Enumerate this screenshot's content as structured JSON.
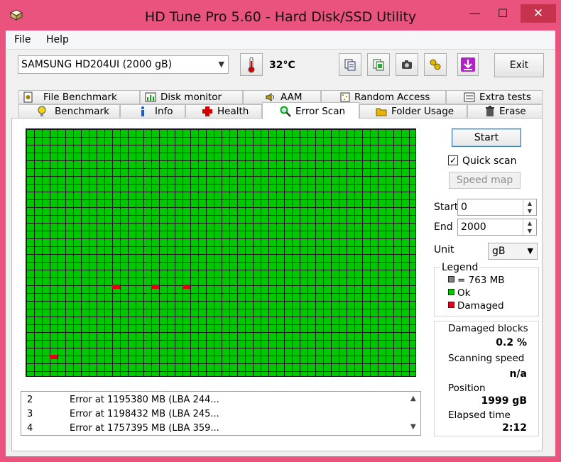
{
  "window": {
    "title": "HD Tune Pro 5.60 - Hard Disk/SSD Utility",
    "min_glyph": "—",
    "max_glyph": "☐",
    "close_glyph": "✕"
  },
  "menu": [
    {
      "label": "File"
    },
    {
      "label": "Help"
    }
  ],
  "toolbar": {
    "drive": "SAMSUNG HD204UI (2000 gB)",
    "temperature": "32°C",
    "exit_label": "Exit",
    "buttons": [
      "copy-text-icon",
      "copy-info-icon",
      "screenshot-camera-icon",
      "options-icon",
      "save-download-icon"
    ]
  },
  "tabs_top": [
    {
      "label": "File Benchmark",
      "icon": "file-benchmark-icon"
    },
    {
      "label": "Disk monitor",
      "icon": "disk-monitor-icon"
    },
    {
      "label": "AAM",
      "icon": "speaker-icon"
    },
    {
      "label": "Random Access",
      "icon": "random-access-icon"
    },
    {
      "label": "Extra tests",
      "icon": "extra-tests-icon"
    }
  ],
  "tabs_bottom": [
    {
      "label": "Benchmark",
      "icon": "bulb-icon"
    },
    {
      "label": "Info",
      "icon": "info-icon"
    },
    {
      "label": "Health",
      "icon": "health-cross-icon"
    },
    {
      "label": "Error Scan",
      "icon": "magnifier-icon",
      "active": true
    },
    {
      "label": "Folder Usage",
      "icon": "folder-icon"
    },
    {
      "label": "Erase",
      "icon": "trash-icon"
    }
  ],
  "scan_map": {
    "cols": 50,
    "rows": 32,
    "damaged_cells": [
      [
        11,
        20
      ],
      [
        16,
        20
      ],
      [
        20,
        20
      ],
      [
        3,
        29
      ]
    ]
  },
  "error_log": [
    {
      "num": "2",
      "text": "Error at 1195380 MB (LBA 244..."
    },
    {
      "num": "3",
      "text": "Error at 1198432 MB (LBA 245..."
    },
    {
      "num": "4",
      "text": "Error at 1757395 MB (LBA 359..."
    }
  ],
  "controls": {
    "start_button": "Start",
    "quick_scan_label": "Quick scan",
    "quick_scan_checked": true,
    "speed_map_button": "Speed map",
    "start_label": "Start",
    "start_value": "0",
    "end_label": "End",
    "end_value": "2000",
    "unit_label": "Unit",
    "unit_value": "gB"
  },
  "legend": {
    "title": "Legend",
    "items": [
      {
        "label": "= 763 MB",
        "color": "#808080"
      },
      {
        "label": "Ok",
        "color": "#00c800"
      },
      {
        "label": "Damaged",
        "color": "#e3001b"
      }
    ]
  },
  "stats": {
    "damaged_blocks_label": "Damaged blocks",
    "damaged_blocks_value": "0.2 %",
    "scanning_speed_label": "Scanning speed",
    "scanning_speed_value": "n/a",
    "position_label": "Position",
    "position_value": "1999 gB",
    "elapsed_label": "Elapsed time",
    "elapsed_value": "2:12"
  },
  "colors": {
    "window_frame": "#e9537d",
    "ok": "#00c800",
    "damaged": "#e3001b",
    "gridline": "#1a1a1a"
  }
}
